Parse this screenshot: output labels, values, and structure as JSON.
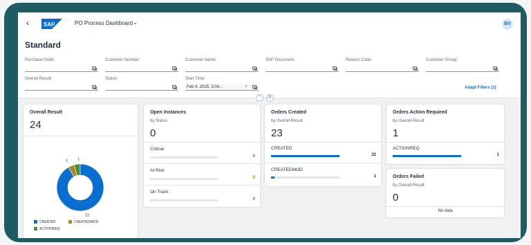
{
  "shell": {
    "back_icon": "chevron-left-icon",
    "logo": "SAP",
    "app_title": "PO Process Dashboard",
    "title_menu_icon": "chevron-down-icon",
    "avatar": "BV"
  },
  "header": {
    "variant": "Standard",
    "filters": [
      {
        "label": "Purchase Order:",
        "value": ""
      },
      {
        "label": "Customer Number:",
        "value": ""
      },
      {
        "label": "Customer Name:",
        "value": ""
      },
      {
        "label": "SAP Document:",
        "value": ""
      },
      {
        "label": "Reason Code:",
        "value": ""
      },
      {
        "label": "Customer Group:",
        "value": ""
      },
      {
        "label": "Overall Result:",
        "value": ""
      },
      {
        "label": "Status:",
        "value": ""
      },
      {
        "label": "Start Time:",
        "value": "Feb 4, 2025, 3:04..."
      }
    ],
    "adapt_filters": "Adapt Filters (1)",
    "collapse_icon": "chevron-up-icon",
    "pin_icon": "pin-icon"
  },
  "cards": {
    "overall": {
      "title": "Overall Result",
      "value": "24",
      "legend": [
        {
          "label": "CREATED",
          "color": "#0a6ed1"
        },
        {
          "label": "CREATEDMOD",
          "color": "#a88a1d"
        },
        {
          "label": "ACTIONREQ",
          "color": "#4d8c3c"
        }
      ],
      "donut_labels": {
        "created": "22",
        "createdmod": "1",
        "actionreq": "1"
      }
    },
    "open": {
      "title": "Open Instances",
      "subtitle": "by Status",
      "value": "0",
      "rows": [
        {
          "label": "Critical",
          "value": "0",
          "fraction": 0
        },
        {
          "label": "At Risk",
          "value": "0",
          "fraction": 0
        },
        {
          "label": "On Track",
          "value": "0",
          "fraction": 0
        }
      ]
    },
    "created": {
      "title": "Orders Created",
      "subtitle": "by Overall Result",
      "value": "23",
      "rows": [
        {
          "label": "CREATED",
          "value": "22",
          "fraction": 1.0
        },
        {
          "label": "CREATEDMOD",
          "value": "1",
          "fraction": 0.045
        }
      ]
    },
    "action": {
      "title": "Orders Action Required",
      "subtitle": "by Overall Result",
      "value": "1",
      "rows": [
        {
          "label": "ACTIONREQ",
          "value": "1",
          "fraction": 1.0
        }
      ]
    },
    "failed": {
      "title": "Orders Failed",
      "subtitle": "by Overall Result",
      "value": "0",
      "no_data": "No data"
    }
  },
  "chart_data": {
    "type": "pie",
    "categories": [
      "CREATED",
      "CREATEDMOD",
      "ACTIONREQ"
    ],
    "values": [
      22,
      1,
      1
    ],
    "colors": [
      "#0a6ed1",
      "#a88a1d",
      "#4d8c3c"
    ],
    "title": "Overall Result",
    "legend_position": "bottom-left"
  }
}
